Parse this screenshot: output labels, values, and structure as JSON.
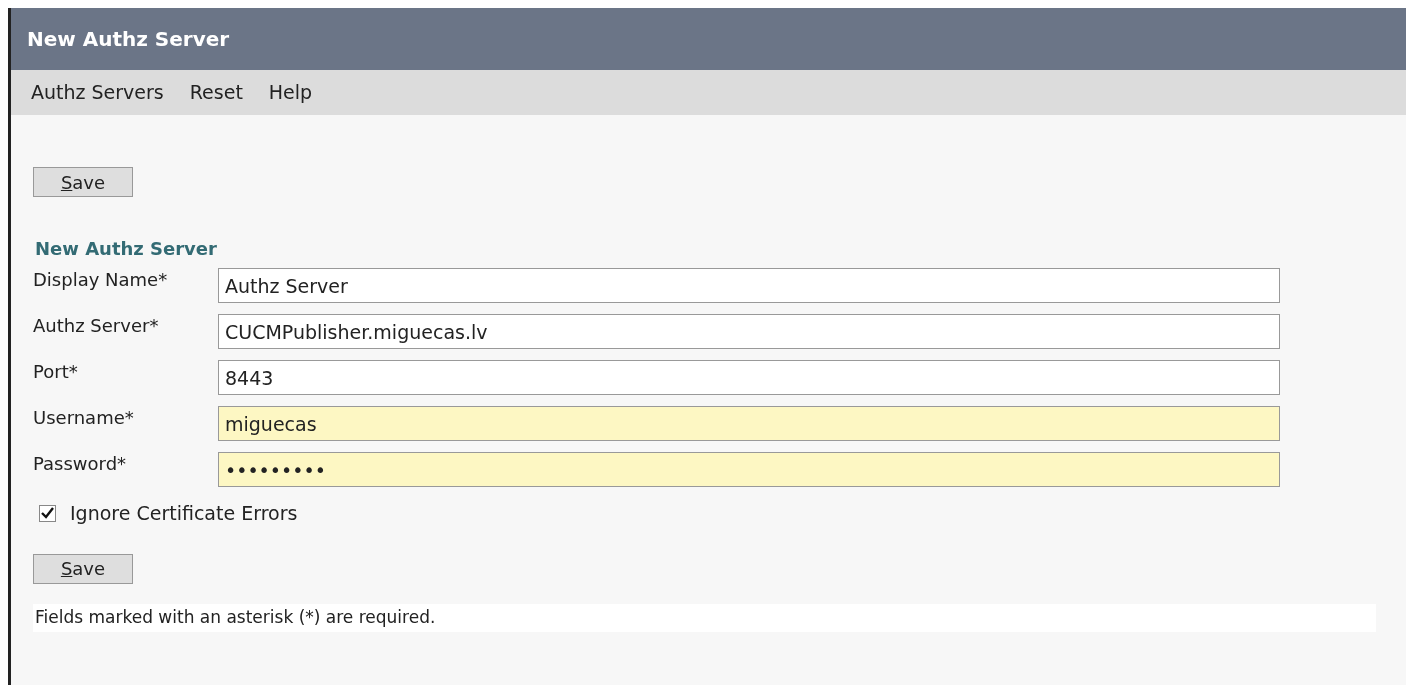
{
  "window": {
    "title": "New Authz Server"
  },
  "menu": [
    {
      "label": "Authz Servers"
    },
    {
      "label": "Reset"
    },
    {
      "label": "Help"
    }
  ],
  "top_button": "Save",
  "section_title": "New Authz Server",
  "fields": [
    {
      "label": "Display Name*",
      "value": "Authz Server",
      "highlighted": false
    },
    {
      "label": "Authz Server*",
      "value": "CUCMPublisher.miguecas.lv",
      "highlighted": false
    },
    {
      "label": "Port*",
      "value": "8443",
      "highlighted": false
    },
    {
      "label": "Username*",
      "value": "miguecas",
      "highlighted": true
    },
    {
      "label": "Password*",
      "value": "•••••••••",
      "highlighted": true
    }
  ],
  "checkbox": {
    "label": "Ignore Certificate Errors",
    "checked": true
  },
  "bottom_button": "Save",
  "footnote": "Fields marked with an asterisk (*) are required."
}
